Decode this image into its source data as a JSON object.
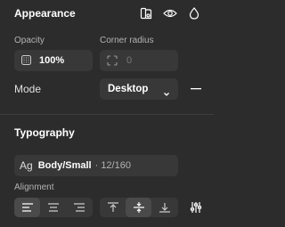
{
  "appearance": {
    "title": "Appearance",
    "icons": [
      "styles-icon",
      "eye-icon",
      "drop-icon"
    ],
    "opacity_label": "Opacity",
    "opacity_value": "100%",
    "radius_label": "Corner radius",
    "radius_value": "0",
    "mode_label": "Mode",
    "mode_value": "Desktop"
  },
  "typography": {
    "title": "Typography",
    "style_prefix": "Ag",
    "style_name": "Body/Small",
    "style_meta": "· 12/160",
    "alignment_label": "Alignment",
    "horizontal_align": [
      "align-left-icon",
      "align-center-icon",
      "align-right-icon"
    ],
    "vertical_align": [
      "align-top-icon",
      "align-middle-icon",
      "align-bottom-icon"
    ],
    "selected_horizontal": "align-left-icon",
    "selected_vertical": "align-middle-icon"
  },
  "colors": {
    "panel": "#2c2c2c",
    "field": "#383838",
    "text": "#ffffff",
    "muted": "#b3b3b3"
  }
}
